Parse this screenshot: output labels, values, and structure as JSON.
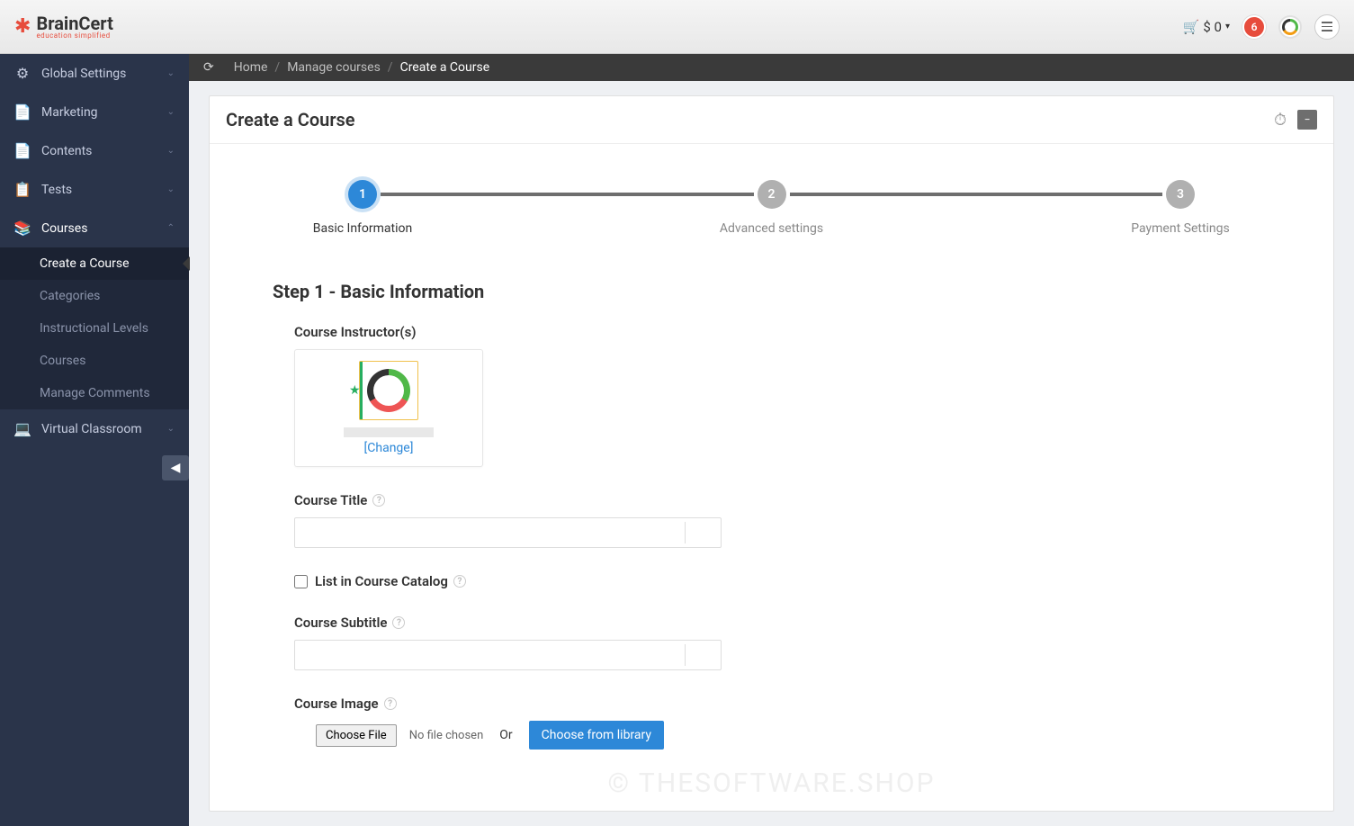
{
  "brand": {
    "name": "BrainCert",
    "tagline": "education simplified"
  },
  "topbar": {
    "cart_amount": "$ 0",
    "notifications": "6"
  },
  "sidebar": {
    "items": [
      {
        "label": "Global Settings",
        "icon": "gear"
      },
      {
        "label": "Marketing",
        "icon": "doc"
      },
      {
        "label": "Contents",
        "icon": "doc"
      },
      {
        "label": "Tests",
        "icon": "clipboard"
      },
      {
        "label": "Courses",
        "icon": "book",
        "expanded": true,
        "children": [
          {
            "label": "Create a Course",
            "active": true
          },
          {
            "label": "Categories"
          },
          {
            "label": "Instructional Levels"
          },
          {
            "label": "Courses"
          },
          {
            "label": "Manage Comments"
          }
        ]
      },
      {
        "label": "Virtual Classroom",
        "icon": "laptop"
      }
    ]
  },
  "breadcrumbs": {
    "home": "Home",
    "manage": "Manage courses",
    "current": "Create a Course"
  },
  "card": {
    "title": "Create a Course"
  },
  "steps": {
    "s1": {
      "num": "1",
      "label": "Basic Information"
    },
    "s2": {
      "num": "2",
      "label": "Advanced settings"
    },
    "s3": {
      "num": "3",
      "label": "Payment Settings"
    }
  },
  "form": {
    "step_heading": "Step 1 - Basic Information",
    "instructor_label": "Course Instructor(s)",
    "change_link": "[Change]",
    "title_label": "Course Title",
    "catalog_label": "List in Course Catalog",
    "subtitle_label": "Course Subtitle",
    "image_label": "Course Image",
    "choose_file": "Choose File",
    "no_file": "No file chosen",
    "or": "Or",
    "library_btn": "Choose from library"
  },
  "watermark": "© THESOFTWARE.SHOP"
}
